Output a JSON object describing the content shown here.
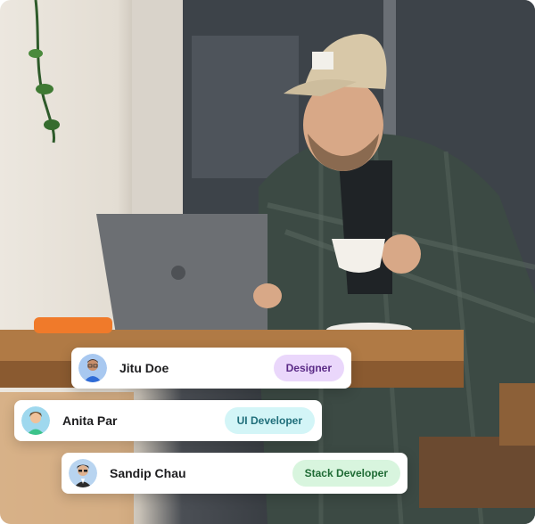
{
  "team": [
    {
      "name": "Jitu Doe",
      "role": "Designer",
      "role_bg": "#ead7fb",
      "role_fg": "#5a2a86",
      "avatar_bg": "#a8c8f0"
    },
    {
      "name": "Anita Par",
      "role": "UI Developer",
      "role_bg": "#d3f5f7",
      "role_fg": "#1f6e7a",
      "avatar_bg": "#9fd8ee"
    },
    {
      "name": "Sandip Chau",
      "role": "Stack Developer",
      "role_bg": "#d8f5de",
      "role_fg": "#1f6b35",
      "avatar_bg": "#b8d4f0"
    }
  ]
}
